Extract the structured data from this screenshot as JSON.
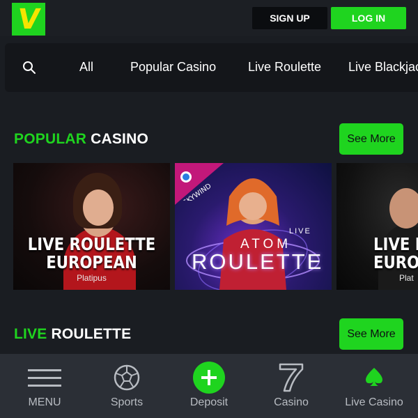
{
  "header": {
    "logo_text": "V",
    "signup_label": "SIGN UP",
    "login_label": "LOG IN"
  },
  "category_nav": {
    "search_icon": "search-icon",
    "items": [
      "All",
      "Popular Casino",
      "Live Roulette",
      "Live Blackjack"
    ]
  },
  "sections": [
    {
      "title_accent": "POPULAR",
      "title_rest": " CASINO",
      "see_more_label": "See More",
      "cards": [
        {
          "title_line1": "LIVE ROULETTE",
          "title_line2": "EUROPEAN",
          "provider": "Platipus"
        },
        {
          "badge": "SKYWIND",
          "title_small": "LIVE",
          "title_mid": "ATOM",
          "title_main": "ROULETTE"
        },
        {
          "title_line1": "LIVE RO",
          "title_line2": "EUROPI",
          "provider": "Plat"
        }
      ]
    },
    {
      "title_accent": "LIVE",
      "title_rest": " ROULETTE",
      "see_more_label": "See More"
    }
  ],
  "bottom_nav": {
    "items": [
      {
        "label": "MENU",
        "icon": "menu-icon"
      },
      {
        "label": "Sports",
        "icon": "soccer-ball-icon"
      },
      {
        "label": "Deposit",
        "icon": "plus-icon"
      },
      {
        "label": "Casino",
        "icon": "seven-icon"
      },
      {
        "label": "Live Casino",
        "icon": "spade-icon"
      }
    ]
  },
  "colors": {
    "accent": "#1fd41f",
    "logo_letter": "#f5e400",
    "background": "#1a1d22",
    "bottom_nav": "#2b2f36"
  }
}
